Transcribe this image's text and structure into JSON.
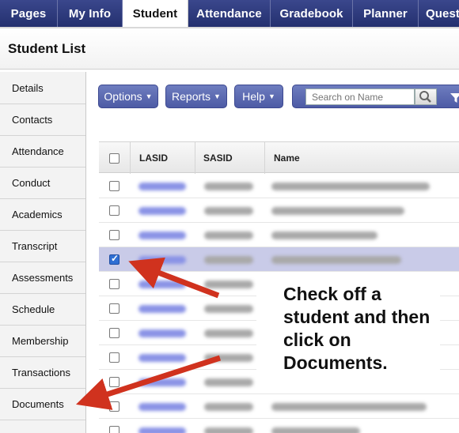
{
  "nav": {
    "tabs": [
      {
        "label": "Pages"
      },
      {
        "label": "My Info"
      },
      {
        "label": "Student",
        "active": true
      },
      {
        "label": "Attendance"
      },
      {
        "label": "Gradebook"
      },
      {
        "label": "Planner"
      },
      {
        "label": "Quest"
      }
    ]
  },
  "page": {
    "title": "Student List"
  },
  "sidebar": {
    "items": [
      {
        "label": "Details"
      },
      {
        "label": "Contacts"
      },
      {
        "label": "Attendance"
      },
      {
        "label": "Conduct"
      },
      {
        "label": "Academics"
      },
      {
        "label": "Transcript"
      },
      {
        "label": "Assessments"
      },
      {
        "label": "Schedule"
      },
      {
        "label": "Membership"
      },
      {
        "label": "Transactions"
      },
      {
        "label": "Documents"
      }
    ]
  },
  "toolbar": {
    "options_label": "Options",
    "reports_label": "Reports",
    "help_label": "Help",
    "search_placeholder": "Search on Name"
  },
  "table": {
    "columns": [
      "LASID",
      "SASID",
      "Name"
    ],
    "rows": [
      {
        "checked": false
      },
      {
        "checked": false
      },
      {
        "checked": false
      },
      {
        "checked": true
      },
      {
        "checked": false
      },
      {
        "checked": false
      },
      {
        "checked": false
      },
      {
        "checked": false
      },
      {
        "checked": false
      },
      {
        "checked": false
      },
      {
        "checked": false
      }
    ]
  },
  "callout": {
    "text": "Check off a student and then click on Documents."
  },
  "colors": {
    "nav_bg": "#1f2b6e",
    "button": "#5a68b0",
    "selected_row": "#c9cbe8",
    "arrow": "#d0321e"
  }
}
